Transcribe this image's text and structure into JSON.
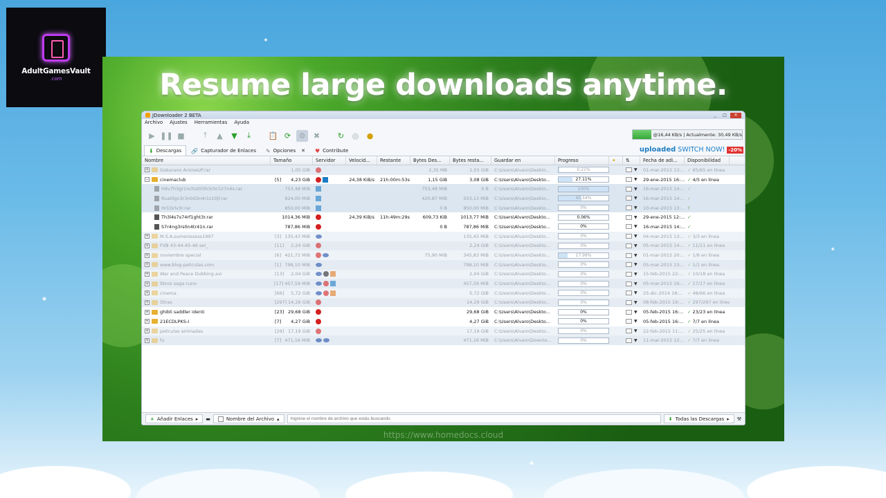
{
  "branding": {
    "name": "AdultGamesVault",
    "sub": ".com"
  },
  "headline": "Resume large downloads anytime.",
  "watermark": "https://www.homedocs.cloud",
  "window": {
    "title": "JDownloader 2 BETA",
    "controls": [
      "_",
      "□",
      "✕"
    ]
  },
  "menu": [
    "Archivo",
    "Ajustes",
    "Herramientas",
    "Ayuda"
  ],
  "speed": "@16,44 KB/s | Actualmente: 30,49 KB/s",
  "tabs": [
    {
      "label": "Descargas",
      "icon": "download-icon"
    },
    {
      "label": "Capturador de Enlaces",
      "icon": "linkgrabber-icon"
    },
    {
      "label": "Opciones",
      "icon": "settings-icon"
    },
    {
      "label": "Contribute",
      "icon": "heart-icon"
    }
  ],
  "promo": {
    "brand": "uploaded",
    "cta": "SWITCH NOW!",
    "discount": "-20%"
  },
  "columns": [
    "Nombre",
    "Tamaño",
    "Servidor",
    "Velocid...",
    "Restante",
    "Bytes Des...",
    "Bytes resta...",
    "Guardar en",
    "Progreso",
    "",
    "",
    "Fecha de adi...",
    "Disponibilidad"
  ],
  "rows": [
    {
      "type": "pkg",
      "dim": true,
      "exp": "+",
      "name": "Gokurano AnimeUP.rar",
      "size": "1,05 GiB",
      "servers": [
        "mega"
      ],
      "speed": "",
      "rem": "",
      "bytes": "2,35 MB",
      "brest": "1,03 GiB",
      "save": "C:\\Users\\Alvaro\\Deskto...",
      "prog": "0.21%",
      "pct": 0.21,
      "date": "01-mar-2015 13:...",
      "avail": "65/65 en línea"
    },
    {
      "type": "pkg",
      "dim": false,
      "exp": "−",
      "name": "cinemaclub",
      "size": "4,23 GiB",
      "count": "[5]",
      "servers": [
        "mega",
        "up"
      ],
      "speed": "24,38 KiB/s",
      "rem": "21h:00m:53s",
      "bytes": "1,15 GiB",
      "brest": "3,08 GiB",
      "save": "C:\\Users\\Alvaro\\Deskto...",
      "prog": "27.11%",
      "pct": 27.11,
      "date": "29-ene-2015 16:...",
      "avail": "4/5 en línea"
    },
    {
      "type": "file",
      "dim": true,
      "name": "H9v7h3gr1nchsl0l3h3chr127n4s.rar",
      "size": "753,48 MiB",
      "servers": [
        "up"
      ],
      "speed": "",
      "rem": "",
      "bytes": "753,48 MiB",
      "brest": "0 B",
      "save": "C:\\Users\\Alvaro\\Deskto...",
      "prog": "100%",
      "pct": 100,
      "date": "16-mar-2015 14:...",
      "avail": "✓"
    },
    {
      "type": "file",
      "dim": true,
      "name": "Rua0lgn3r3n0d3n4r1z10jf.rar",
      "size": "924,00 MiB",
      "servers": [
        "up"
      ],
      "speed": "",
      "rem": "",
      "bytes": "420,87 MiB",
      "brest": "503,13 MiB",
      "save": "C:\\Users\\Alvaro\\Deskto...",
      "prog": "45.54%",
      "pct": 45.54,
      "date": "16-mar-2015 14:...",
      "avail": "✓"
    },
    {
      "type": "file",
      "dim": true,
      "sel": true,
      "name": "Hr1Drlv3r.rar",
      "size": "850,00 MiB",
      "servers": [
        "up"
      ],
      "speed": "",
      "rem": "",
      "bytes": "0 B",
      "brest": "850,00 MiB",
      "save": "C:\\Users\\Alvaro\\Deskto...",
      "prog": "0%",
      "pct": 0,
      "date": "10-mar-2015 13:...",
      "avail": "?"
    },
    {
      "type": "file",
      "dim": false,
      "name": "Th3l4s7s74rf1ght3r.rar",
      "size": "1014,36 MiB",
      "servers": [
        "mega"
      ],
      "speed": "24,39 KiB/s",
      "rem": "11h:49m:29s",
      "bytes": "609,73 KiB",
      "brest": "1013,77 MiB",
      "save": "C:\\Users\\Alvaro\\Deskto...",
      "prog": "0.06%",
      "pct": 0.06,
      "date": "29-ene-2015 12:...",
      "avail": "✓"
    },
    {
      "type": "file",
      "dim": false,
      "name": "S7r4ng3rs0n4tr41n.rar",
      "size": "787,86 MiB",
      "servers": [
        "mega"
      ],
      "speed": "",
      "rem": "",
      "bytes": "0 B",
      "brest": "787,86 MiB",
      "save": "C:\\Users\\Alvaro\\Deskto...",
      "prog": "0%",
      "pct": 0,
      "date": "16-mar-2015 14:...",
      "avail": "✓"
    },
    {
      "type": "pkg",
      "dim": true,
      "exp": "+",
      "name": "M.S.A.sumerssssss1997",
      "size": "135,43 MiB",
      "count": "[3]",
      "servers": [
        "blue"
      ],
      "speed": "",
      "rem": "",
      "bytes": "",
      "brest": "135,43 MiB",
      "save": "C:\\Users\\Alvaro\\Deskto...",
      "prog": "0%",
      "pct": 0,
      "date": "04-mar-2015 13:...",
      "avail": "3/3 en línea"
    },
    {
      "type": "pkg",
      "dim": true,
      "exp": "+",
      "name": "FVB 43-44-45-46 ser_",
      "size": "2,24 GiB",
      "count": "[11]",
      "servers": [
        "mega"
      ],
      "speed": "",
      "rem": "",
      "bytes": "",
      "brest": "2,24 GiB",
      "save": "C:\\Users\\Alvaro\\Deskto...",
      "prog": "0%",
      "pct": 0,
      "date": "05-mar-2015 14:...",
      "avail": "11/11 en línea"
    },
    {
      "type": "pkg",
      "dim": true,
      "exp": "+",
      "name": "noviembre special",
      "size": "421,72 MiB",
      "count": "[6]",
      "servers": [
        "mega",
        "blue"
      ],
      "speed": "",
      "rem": "",
      "bytes": "75,90 MiB",
      "brest": "345,83 MiB",
      "save": "C:\\Users\\Alvaro\\Deskto...",
      "prog": "17.99%",
      "pct": 17.99,
      "date": "01-mar-2015 20:...",
      "avail": "1/6 en línea"
    },
    {
      "type": "pkg",
      "dim": true,
      "exp": "+",
      "name": "www.blog-peliculas.com",
      "size": "798,10 MiB",
      "count": "[1]",
      "servers": [
        "blue"
      ],
      "speed": "",
      "rem": "",
      "bytes": "",
      "brest": "798,10 MiB",
      "save": "C:\\Users\\Alvaro\\Deskto...",
      "prog": "0%",
      "pct": 0,
      "date": "05-mar-2015 13:...",
      "avail": "1/1 en línea"
    },
    {
      "type": "pkg",
      "dim": true,
      "exp": "+",
      "name": "War and Peace Dubbing.avi",
      "size": "2,04 GiB",
      "count": "[13]",
      "servers": [
        "blue",
        "dark",
        "orange"
      ],
      "speed": "",
      "rem": "",
      "bytes": "",
      "brest": "2,04 GiB",
      "save": "C:\\Users\\Alvaro\\Deskto...",
      "prog": "0%",
      "pct": 0,
      "date": "15-feb-2015 22:...",
      "avail": "10/18 en línea"
    },
    {
      "type": "pkg",
      "dim": true,
      "exp": "+",
      "name": "libros saga cuno",
      "size": "457,59 MiB",
      "count": "[17]",
      "servers": [
        "blue",
        "mega",
        "up"
      ],
      "speed": "",
      "rem": "",
      "bytes": "",
      "brest": "457,59 MiB",
      "save": "C:\\Users\\Alvaro\\Deskto...",
      "prog": "0%",
      "pct": 0,
      "date": "05-mar-2015 16:...",
      "avail": "17/17 en línea"
    },
    {
      "type": "pkg",
      "dim": true,
      "exp": "+",
      "name": "cinema",
      "size": "5,72 GiB",
      "count": "[66]",
      "servers": [
        "blue",
        "mega",
        "orange"
      ],
      "speed": "",
      "rem": "",
      "bytes": "",
      "brest": "5,72 GiB",
      "save": "C:\\Users\\Alvaro\\Deskto...",
      "prog": "0%",
      "pct": 0,
      "date": "25-dic-2014 18:...",
      "avail": "48/66 en línea"
    },
    {
      "type": "pkg",
      "dim": true,
      "exp": "+",
      "name": "Otras",
      "size": "14,29 GiB",
      "count": "[297]",
      "servers": [
        "mega"
      ],
      "speed": "",
      "rem": "",
      "bytes": "",
      "brest": "14,29 GiB",
      "save": "C:\\Users\\Alvaro\\Deskto...",
      "prog": "0%",
      "pct": 0,
      "date": "08-feb-2015 19:...",
      "avail": "297/297 en línea"
    },
    {
      "type": "pkg",
      "dim": false,
      "exp": "+",
      "name": "ghibli saddler identi",
      "size": "29,68 GiB",
      "count": "[23]",
      "servers": [
        "mega"
      ],
      "speed": "",
      "rem": "",
      "bytes": "",
      "brest": "29,68 GiB",
      "save": "C:\\Users\\Alvaro\\Deskto...",
      "prog": "0%",
      "pct": 0,
      "date": "05-feb-2015 16:...",
      "avail": "23/23 en línea"
    },
    {
      "type": "pkg",
      "dim": false,
      "exp": "+",
      "name": "21ECDLPKS-I",
      "size": "4,27 GiB",
      "count": "[7]",
      "servers": [
        "mega"
      ],
      "speed": "",
      "rem": "",
      "bytes": "",
      "brest": "4,27 GiB",
      "save": "C:\\Users\\Alvaro\\Deskto...",
      "prog": "0%",
      "pct": 0,
      "date": "05-feb-2015 16:...",
      "avail": "7/7 en línea"
    },
    {
      "type": "pkg",
      "dim": true,
      "exp": "+",
      "name": "peliculas animadas",
      "size": "17,19 GiB",
      "count": "[29]",
      "servers": [
        "mega"
      ],
      "speed": "",
      "rem": "",
      "bytes": "",
      "brest": "17,19 GiB",
      "save": "C:\\Users\\Alvaro\\Deskto...",
      "prog": "0%",
      "pct": 0,
      "date": "22-feb-2015 11:...",
      "avail": "25/25 en línea"
    },
    {
      "type": "pkg",
      "dim": true,
      "exp": "+",
      "name": "fu",
      "size": "471,16 MiB",
      "count": "[7]",
      "servers": [
        "blue",
        "blue"
      ],
      "speed": "",
      "rem": "",
      "bytes": "",
      "brest": "471,16 MiB",
      "save": "C:\\Users\\Alvaro\\Downlo...",
      "prog": "0%",
      "pct": 0,
      "date": "11-mar-2015 12:...",
      "avail": "7/7 en línea"
    }
  ],
  "bottom": {
    "add_links": "Añadir Enlaces",
    "filename_label": "Nombre del Archivo",
    "search_placeholder": "Ingrese el nombre de archivo que estás buscando",
    "all_downloads": "Todas las Descargas"
  }
}
